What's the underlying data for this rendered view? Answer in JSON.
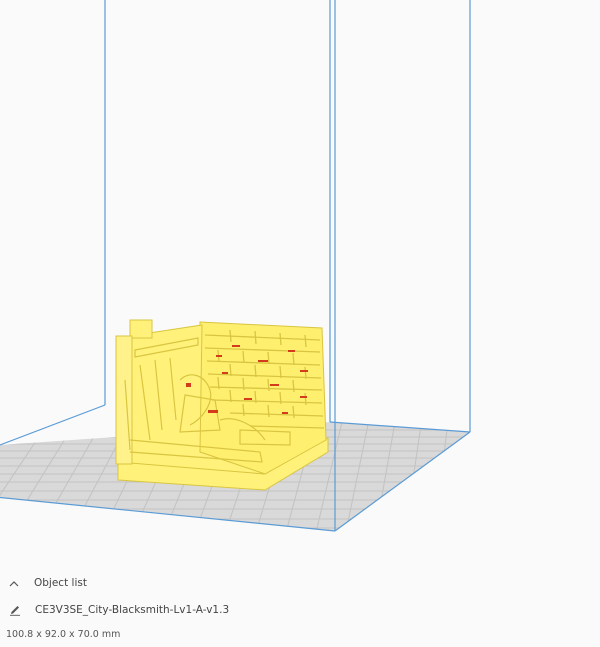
{
  "object_list": {
    "header_label": "Object list",
    "collapse_icon": "chevron-up-icon",
    "edit_icon": "pencil-icon",
    "file_name": "CE3V3SE_City-Blacksmith-Lv1-A-v1.3",
    "dimensions": "100.8 x 92.0 x 70.0 mm"
  },
  "colors": {
    "background": "#fafafa",
    "build_volume_line": "#5b9bd5",
    "grid_plate": "#d9d9d9",
    "grid_line": "#c2c2c2",
    "model_fill": "#fff17a",
    "model_shadow": "#d9c540",
    "overhang": "#d43a1c"
  }
}
